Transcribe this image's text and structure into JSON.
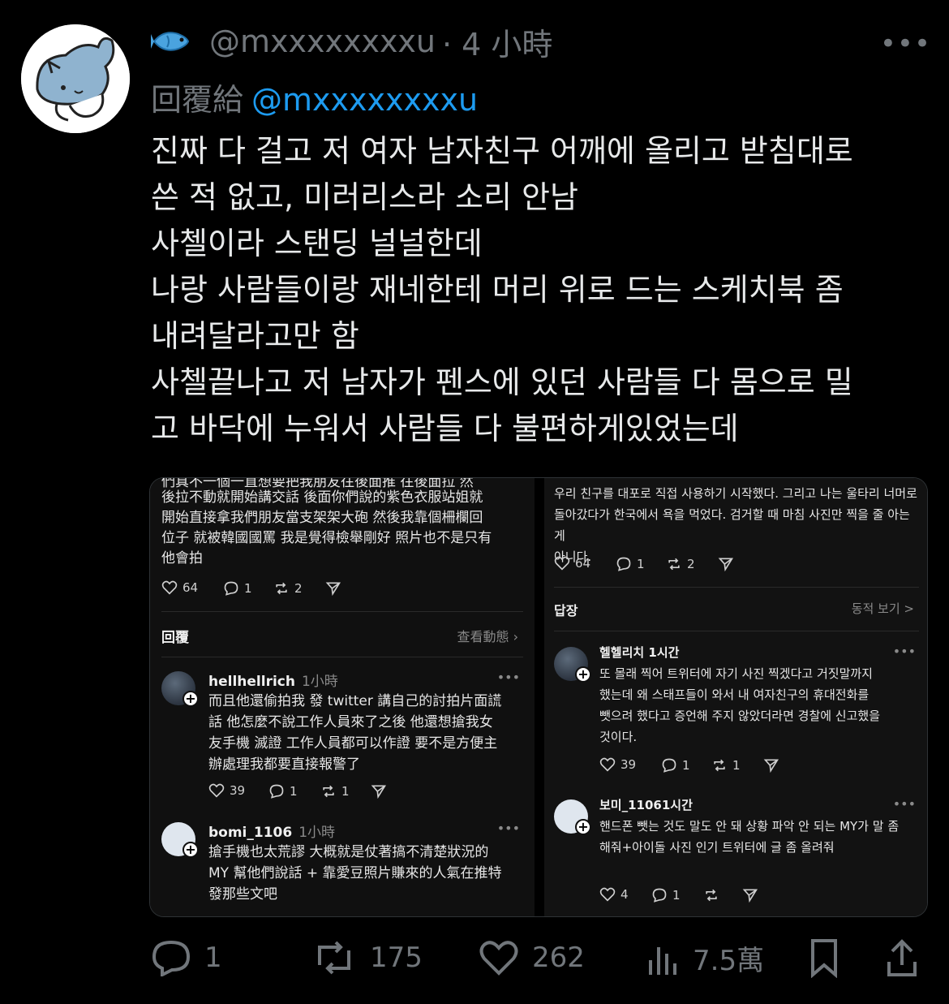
{
  "tweet": {
    "handle": "@mxxxxxxxxu",
    "time": "· 4 小時",
    "more": "•••",
    "reply_label": "回覆給",
    "reply_handle": "@mxxxxxxxxu",
    "lines": [
      "진짜 다 걸고 저 여자 남자친구 어깨에 올리고 받침대로",
      "쓴 적 없고, 미러리스라 소리 안남",
      "사첼이라 스탠딩 널널한데",
      "나랑 사람들이랑 재네한테 머리 위로 드는 스케치북 좀",
      "내려달라고만 함",
      "사첼끝나고 저 남자가 펜스에 있던 사람들 다 몸으로 밀",
      "고 바닥에 누워서 사람들 다 불편하게있었는데"
    ]
  },
  "left_panel": {
    "cut_line": "們真不一個一直想要把我朋友往後面推 往後面拉 然",
    "post_lines": [
      "後拉不動就開始講交話 後面你們說的紫色衣服站姐就",
      "開始直接拿我們朋友當支架架大砲 然後我靠個柵欄回",
      "位子 就被韓國國罵 我是覺得檢舉剛好 照片也不是只有",
      "他會拍"
    ],
    "actions": {
      "likes": "64",
      "replies": "1",
      "reposts": "2"
    },
    "section_title": "回覆",
    "view_activity": "查看動態 ›",
    "comments": [
      {
        "name": "hellhellrich",
        "time": "1小時",
        "dots": "•••",
        "lines": [
          "而且他還偷拍我 發 twitter 講自己的討拍片面謊",
          "話 他怎麼不說工作人員來了之後 他還想搶我女",
          "友手機 滅證 工作人員都可以作證 要不是方便主",
          "辦處理我都要直接報警了"
        ],
        "likes": "39",
        "replies": "1",
        "reposts": "1"
      },
      {
        "name": "bomi_1106",
        "time": "1小時",
        "dots": "•••",
        "lines": [
          "搶手機也太荒謬 大概就是仗著搞不清楚狀況的",
          "MY 幫他們說話 + 靠愛豆照片賺來的人氣在推特",
          "發那些文吧"
        ]
      }
    ]
  },
  "right_panel": {
    "post_lines": [
      "우리 친구를 대포로 직접 사용하기 시작했다. 그리고 나는 울타리 너머로",
      "돌아갔다가 한국에서 욕을 먹었다. 검거할 때 마침 사진만 찍을 줄 아는 게",
      "아니다."
    ],
    "actions": {
      "likes": "64",
      "replies": "1",
      "reposts": "2"
    },
    "section_title": "답장",
    "view_activity": "동적 보기 >",
    "comments": [
      {
        "name": "헬헬리치 1시간",
        "dots": "•••",
        "lines": [
          "또 몰래 찍어 트위터에 자기 사진 찍겠다고 거짓말까지",
          "했는데 왜 스태프들이 와서 내 여자친구의 휴대전화를",
          "뺏으려 했다고 증언해 주지 않았더라면 경찰에 신고했을",
          "것이다."
        ],
        "likes": "39",
        "replies": "1",
        "reposts": "1"
      },
      {
        "name": "보미_11061시간",
        "dots": "•••",
        "lines": [
          "핸드폰 뺏는 것도 말도 안 돼 상황 파악 안 되는 MY가 말 좀",
          "해줘+아이돌 사진 인기 트위터에 글 좀 올려줘"
        ],
        "likes": "4",
        "replies": "1"
      }
    ]
  },
  "stats": {
    "replies": "1",
    "reposts": "175",
    "likes": "262",
    "views": "7.5萬"
  },
  "colors": {
    "link": "#1d9bf0",
    "muted": "#71767b",
    "text": "#e7e9ea"
  }
}
